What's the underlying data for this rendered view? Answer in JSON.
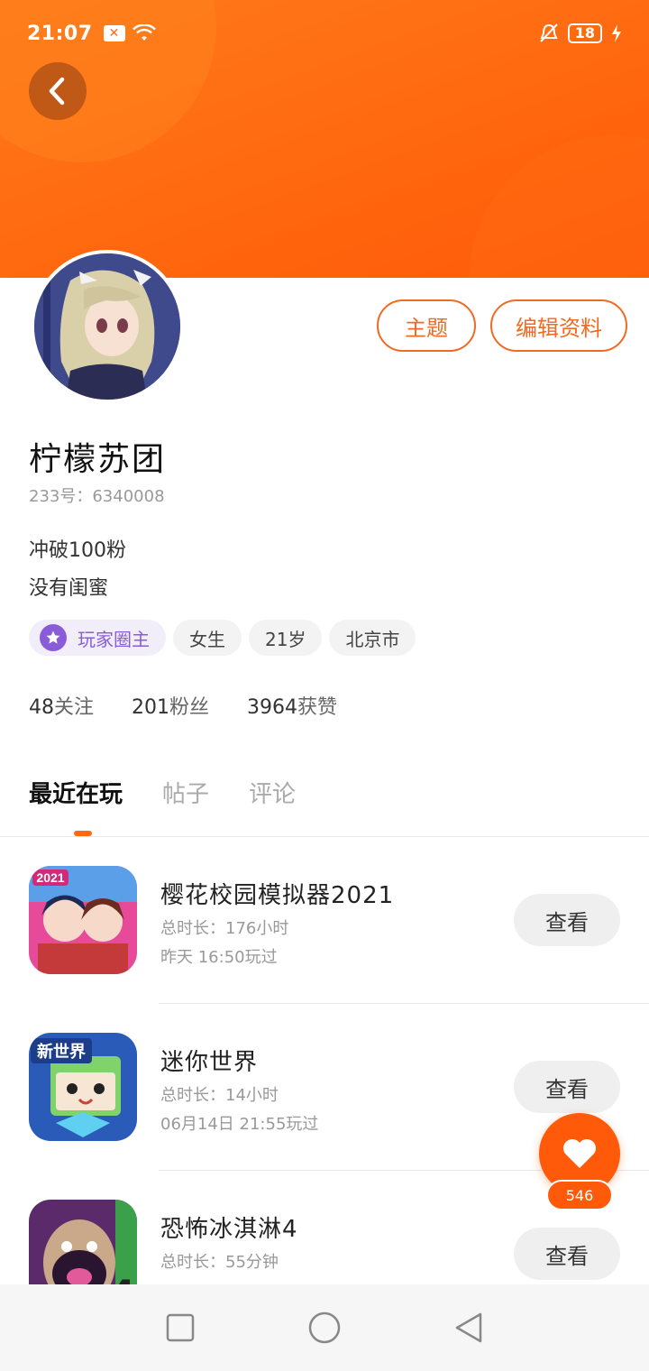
{
  "status_bar": {
    "time": "21:07",
    "battery": "18"
  },
  "profile": {
    "theme_button": "主题",
    "edit_button": "编辑资料",
    "username": "柠檬苏团",
    "uid": "233号：6340008",
    "bio_lines": [
      "冲破100粉",
      "没有闺蜜"
    ],
    "tags": {
      "role": "玩家圈主",
      "gender": "女生",
      "age": "21岁",
      "location": "北京市"
    },
    "stats": {
      "following_count": "48",
      "following_label": "关注",
      "fans_count": "201",
      "fans_label": "粉丝",
      "likes_count": "3964",
      "likes_label": "获赞"
    }
  },
  "tabs": [
    {
      "label": "最近在玩",
      "active": true
    },
    {
      "label": "帖子",
      "active": false
    },
    {
      "label": "评论",
      "active": false
    }
  ],
  "games": [
    {
      "title": "樱花校园模拟器2021",
      "duration": "总时长：176小时",
      "last_played": "昨天 16:50玩过",
      "button": "查看",
      "icon_badge": "2021"
    },
    {
      "title": "迷你世界",
      "duration": "总时长：14小时",
      "last_played": "06月14日 21:55玩过",
      "button": "查看",
      "icon_badge": "新世界"
    },
    {
      "title": "恐怖冰淇淋4",
      "duration": "总时长：55分钟",
      "last_played": "",
      "button": "查看",
      "icon_badge": "4"
    }
  ],
  "favorite": {
    "count": "546"
  },
  "colors": {
    "accent": "#ff6a10",
    "role_purple": "#8a5cd8"
  },
  "icons": {
    "back": "chevron-left-icon",
    "favorite": "heart-icon",
    "role": "star-badge-icon",
    "nav_recent": "square-icon",
    "nav_home": "circle-icon",
    "nav_back": "triangle-back-icon"
  }
}
